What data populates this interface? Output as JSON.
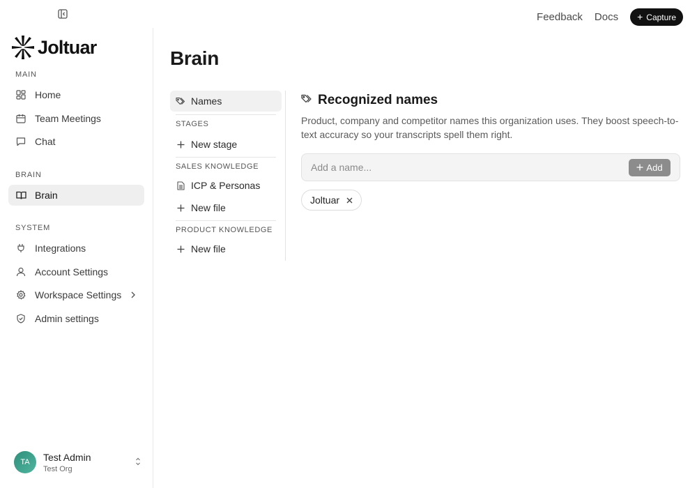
{
  "topbar": {
    "collapse_icon": "sidebar-collapse-icon",
    "links": {
      "feedback": "Feedback",
      "docs": "Docs"
    },
    "capture_label": "Capture"
  },
  "sidebar": {
    "brand": "Joltuar",
    "sections": {
      "main": "MAIN",
      "brain": "BRAIN",
      "system": "SYSTEM"
    },
    "items": {
      "home": {
        "label": "Home",
        "icon": "grid-icon"
      },
      "team_meetings": {
        "label": "Team Meetings",
        "icon": "calendar-icon"
      },
      "chat": {
        "label": "Chat",
        "icon": "chat-icon"
      },
      "brain": {
        "label": "Brain",
        "icon": "book-icon",
        "active": true
      },
      "integrations": {
        "label": "Integrations",
        "icon": "plug-icon"
      },
      "account_settings": {
        "label": "Account Settings",
        "icon": "user-icon"
      },
      "workspace_settings": {
        "label": "Workspace Settings",
        "icon": "gear-icon"
      },
      "admin_settings": {
        "label": "Admin settings",
        "icon": "shield-check-icon"
      }
    },
    "user": {
      "initials": "TA",
      "name": "Test Admin",
      "org": "Test Org"
    }
  },
  "main": {
    "title": "Brain",
    "subnav": {
      "names": "Names",
      "stages_label": "STAGES",
      "new_stage": "New stage",
      "sales_label": "SALES KNOWLEDGE",
      "icp": "ICP & Personas",
      "sales_new_file": "New file",
      "product_label": "PRODUCT KNOWLEDGE",
      "product_new_file": "New file"
    },
    "content": {
      "title": "Recognized names",
      "description": "Product, company and competitor names this organization uses. They boost speech-to-text accuracy so your transcripts spell them right.",
      "input_placeholder": "Add a name...",
      "add_label": "Add",
      "names": [
        "Joltuar"
      ]
    }
  },
  "colors": {
    "accent_dark": "#111111",
    "active_bg": "#efefef",
    "avatar": "#3aa08a"
  }
}
